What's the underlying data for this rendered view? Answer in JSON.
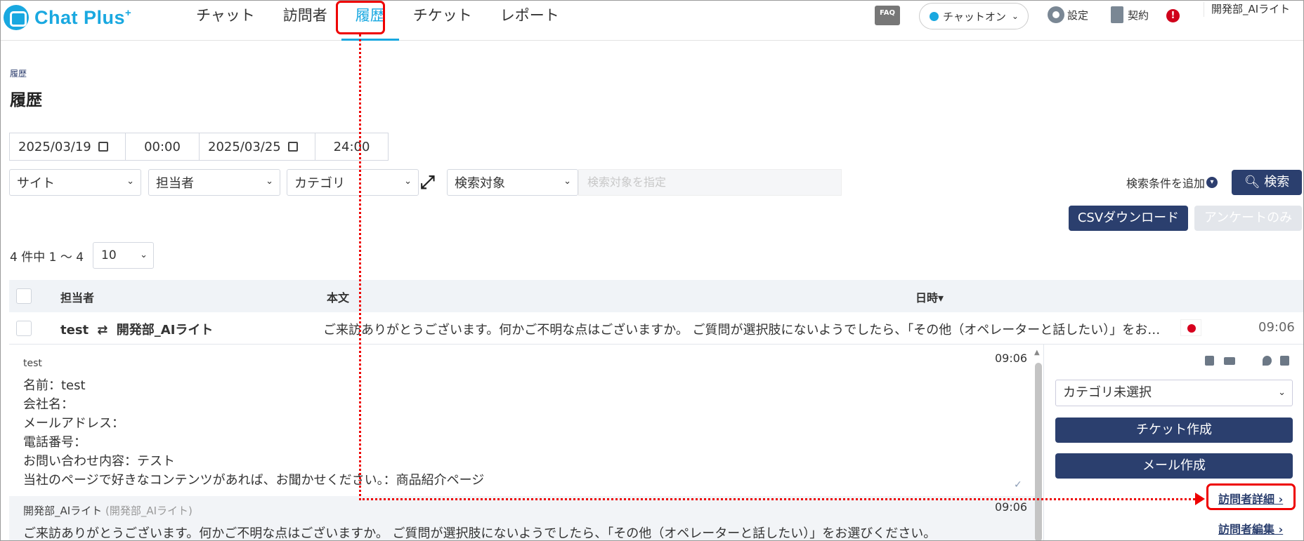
{
  "header": {
    "logo_text": "Chat Plus",
    "logo_plus": "+",
    "nav": [
      "チャット",
      "訪問者",
      "履歴",
      "チケット",
      "レポート"
    ],
    "active_nav": "履歴",
    "faq": "FAQ",
    "chat_status": "チャットオン",
    "settings": "設定",
    "contract": "契約",
    "alert_mark": "!",
    "user_name": "開発部_AIライト"
  },
  "page": {
    "breadcrumb": "履歴",
    "title": "履歴"
  },
  "filters": {
    "date_from": "2025/03/19",
    "time_from": "00:00",
    "date_to": "2025/03/25",
    "time_to": "24:00",
    "site": "サイト",
    "operator": "担当者",
    "category": "カテゴリ",
    "search_target": "検索対象",
    "search_placeholder": "検索対象を指定",
    "add_condition": "検索条件を追加",
    "search_button": "検索",
    "csv_button": "CSVダウンロード",
    "survey_button": "アンケートのみ"
  },
  "pagination": {
    "count_text": "4 件中 1 ～ 4",
    "per_page": "10"
  },
  "table": {
    "headers": [
      "担当者",
      "本文",
      "日時▾"
    ],
    "row": {
      "visitor": "test",
      "arrow": "⇄",
      "operator": "開発部_AIライト",
      "body": "ご来訪ありがとうございます。何かご不明な点はございますか。 ご質問が選択肢にないようでしたら、「その他（オペレーターと話したい）」をお…",
      "time": "09:06"
    }
  },
  "detail": {
    "msg1_sender": "test",
    "msg1_time": "09:06",
    "msg1_lines": [
      "名前：test",
      "会社名：",
      "メールアドレス：",
      "電話番号：",
      "お問い合わせ内容：テスト",
      "当社のページで好きなコンテンツがあれば、お聞かせください。：商品紹介ページ"
    ],
    "msg2_sender": "開発部_AIライト",
    "msg2_sender_sub": "(開発部_AIライト)",
    "msg2_time": "09:06",
    "msg2_text": "ご来訪ありがとうございます。何かご不明な点はございますか。 ご質問が選択肢にないようでしたら、「その他（オペレーターと話したい）」をお選びください。"
  },
  "panel": {
    "category_select": "カテゴリ未選択",
    "ticket_button": "チケット作成",
    "mail_button": "メール作成",
    "visitor_detail_link": "訪問者詳細",
    "visitor_edit_link": "訪問者編集"
  }
}
